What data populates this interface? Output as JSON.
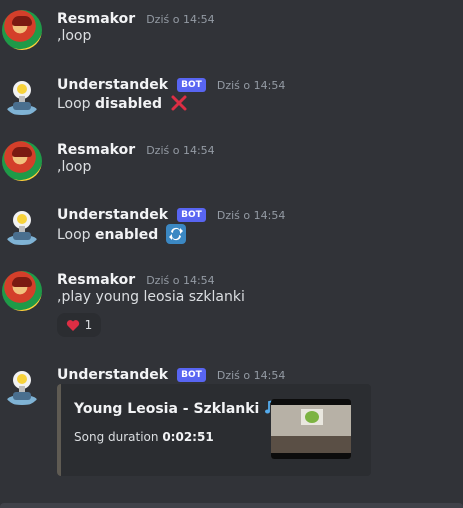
{
  "messages": [
    {
      "author": "Resmakor",
      "time": "Dziś o 14:54",
      "text": ",loop"
    },
    {
      "author": "Understandek",
      "tag": "BOT",
      "time": "Dziś o 14:54",
      "prefix": "Loop",
      "bold": "disabled",
      "emoji": "cross-mark-icon"
    },
    {
      "author": "Resmakor",
      "time": "Dziś o 14:54",
      "text": ",loop"
    },
    {
      "author": "Understandek",
      "tag": "BOT",
      "time": "Dziś o 14:54",
      "prefix": "Loop",
      "bold": "enabled",
      "emoji": "repeat-icon"
    },
    {
      "author": "Resmakor",
      "time": "Dziś o 14:54",
      "text": ",play young leosia szklanki",
      "reaction": {
        "emoji": "heart-icon",
        "count": "1"
      }
    },
    {
      "author": "Understandek",
      "tag": "BOT",
      "time": "Dziś o 14:54",
      "embed": {
        "title": "Young Leosia - Szklanki",
        "title_emoji": "musical-note-icon",
        "field_label": "Song duration",
        "field_value": "0:02:51"
      }
    }
  ],
  "colors": {
    "background": "#313338",
    "bot_tag": "#5865f2",
    "reaction_heart": "#dd2e44",
    "cross": "#dd2e44",
    "repeat": "#3b88c3"
  }
}
